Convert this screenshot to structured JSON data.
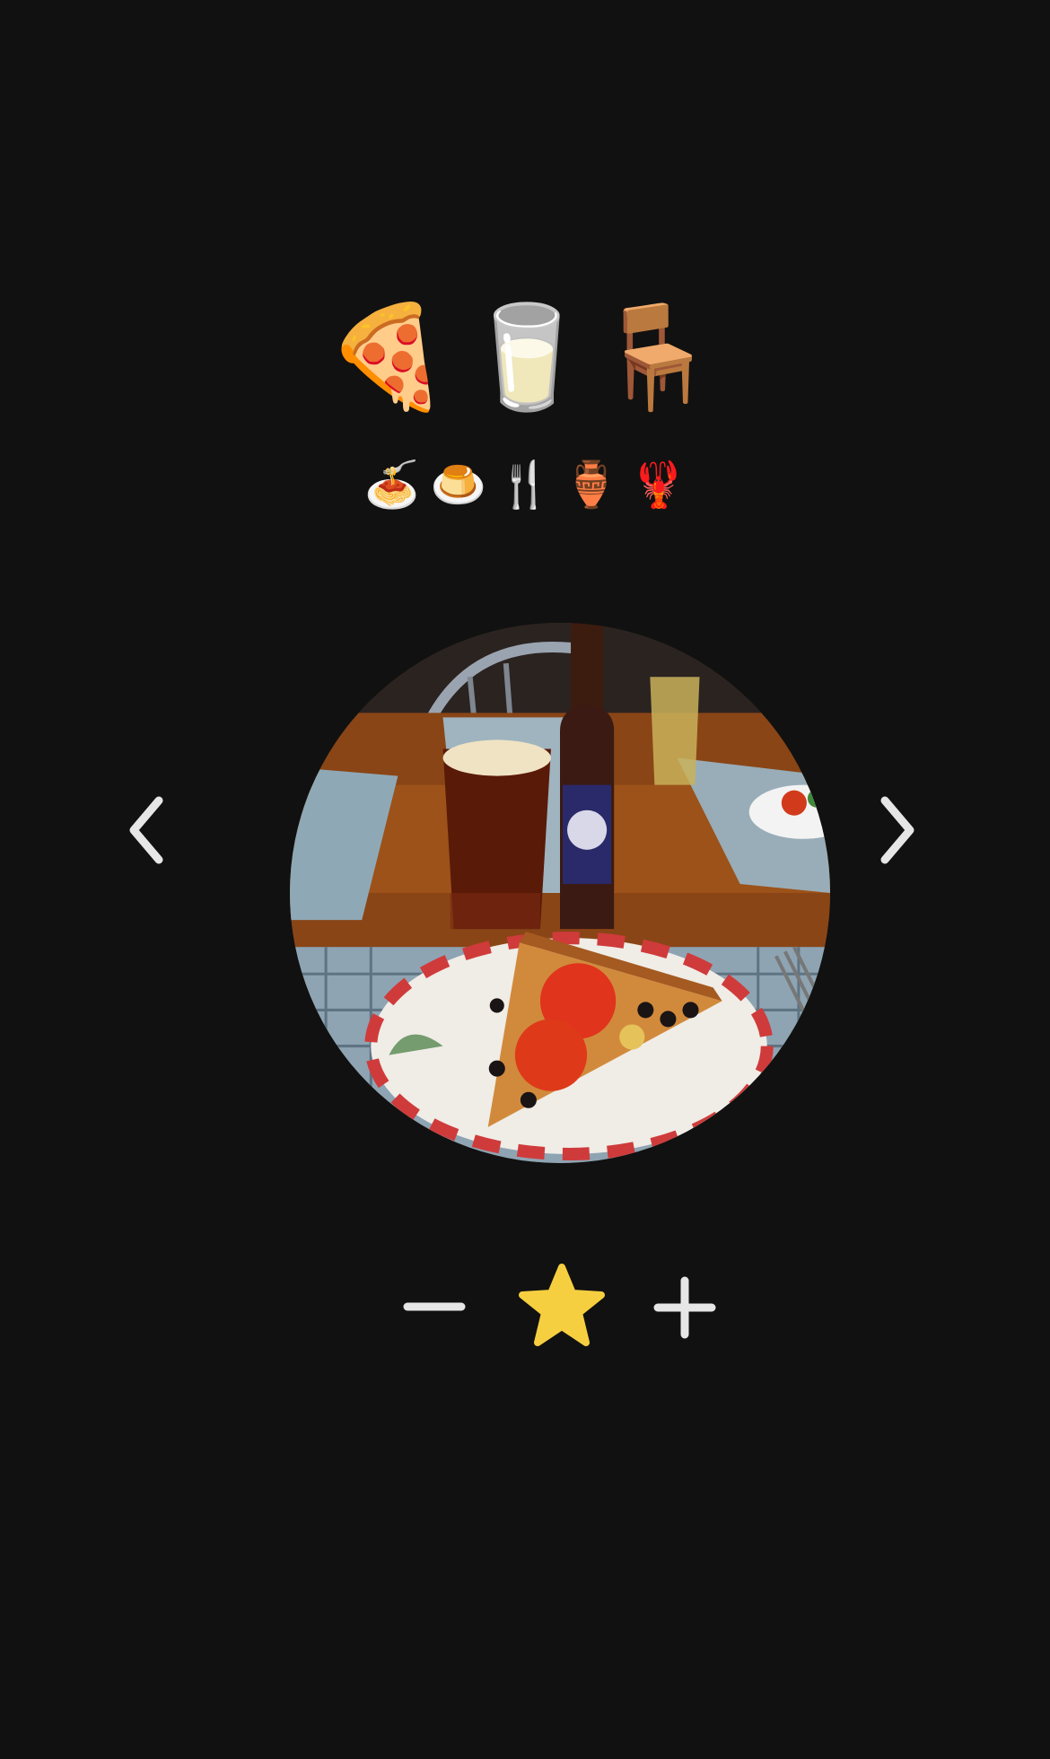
{
  "primary_emojis": [
    {
      "glyph": "🍕",
      "icon": "pizza-icon"
    },
    {
      "glyph": "🥛",
      "icon": "milk-glass-icon"
    },
    {
      "glyph": "🪑",
      "icon": "chair-icon"
    }
  ],
  "secondary_emojis": [
    {
      "glyph": "🍝",
      "icon": "spaghetti-icon"
    },
    {
      "glyph": "🍮",
      "icon": "custard-icon"
    },
    {
      "glyph": "🍴",
      "icon": "fork-knife-icon"
    },
    {
      "glyph": "🏺",
      "icon": "amphora-icon"
    },
    {
      "glyph": "🦞",
      "icon": "lobster-icon"
    }
  ],
  "photo": {
    "subject": "pizza-slice-and-beer-photo"
  },
  "controls": {
    "previous": "chevron-left-icon",
    "next": "chevron-right-icon",
    "decrease": "minus-icon",
    "favorite": "star-icon",
    "increase": "plus-icon"
  },
  "colors": {
    "background": "#111111",
    "icon": "#e6e6e6",
    "star": "#f6cf40"
  }
}
